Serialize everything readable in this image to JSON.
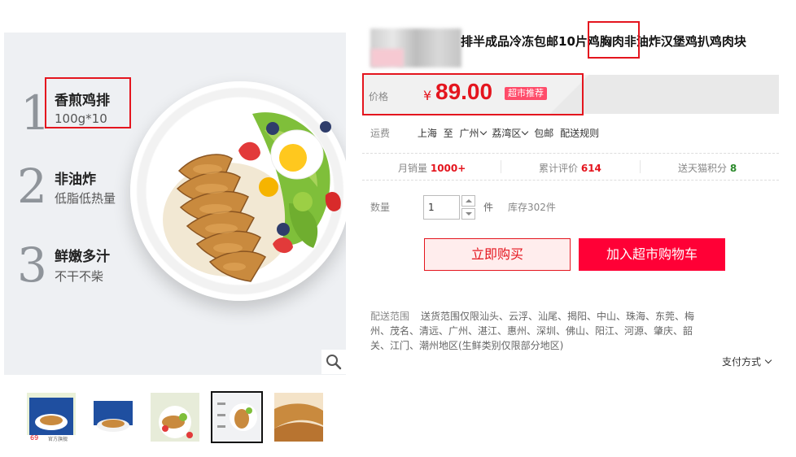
{
  "product": {
    "title": "排半成品冷冻包邮10片鸡胸肉非油炸汉堡鸡扒鸡肉块"
  },
  "gallery": {
    "features": [
      {
        "number": "1",
        "title": "香煎鸡排",
        "subtitle": "100g*10"
      },
      {
        "number": "2",
        "title": "非油炸",
        "subtitle": "低脂低热量"
      },
      {
        "number": "3",
        "title": "鲜嫩多汁",
        "subtitle": "不干不柴"
      }
    ],
    "zoom_icon": "magnifier-icon",
    "thumbnails": [
      {
        "name": "thumb-package-front",
        "badge": "69",
        "caption": "官方旗舰"
      },
      {
        "name": "thumb-package-box"
      },
      {
        "name": "thumb-salad-plate"
      },
      {
        "name": "thumb-feature-plate",
        "active": true
      },
      {
        "name": "thumb-chicken-closeup"
      }
    ]
  },
  "price": {
    "label": "价格",
    "currency": "¥",
    "value": "89.00",
    "badge": "超市推荐"
  },
  "shipping": {
    "label": "运费",
    "from": "上海",
    "to_word": "至",
    "city": "广州",
    "district": "荔湾区",
    "free": "包邮",
    "rules_link": "配送规则"
  },
  "stats": {
    "monthly_sales_label": "月销量",
    "monthly_sales_value": "1000+",
    "reviews_label": "累计评价",
    "reviews_value": "614",
    "points_label": "送天猫积分",
    "points_value": "8"
  },
  "quantity": {
    "label": "数量",
    "value": "1",
    "unit": "件",
    "stock": "库存302件"
  },
  "buttons": {
    "buy_now": "立即购买",
    "add_to_cart": "加入超市购物车"
  },
  "delivery": {
    "label": "配送范围",
    "text": "送货范围仅限汕头、云浮、汕尾、揭阳、中山、珠海、东莞、梅州、茂名、清远、广州、湛江、惠州、深圳、佛山、阳江、河源、肇庆、韶关、江门、潮州地区(生鲜类别仅限部分地区)"
  },
  "payment": {
    "label": "支付方式"
  },
  "colors": {
    "accent_red": "#e4151e",
    "cart_red": "#ff0036",
    "badge_pink": "#ff4c6a",
    "green_points": "#2c8a2c"
  }
}
